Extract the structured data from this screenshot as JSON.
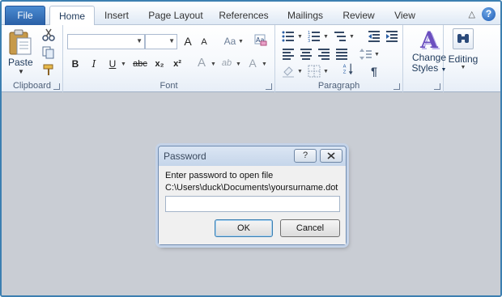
{
  "tabs": {
    "file": "File",
    "items": [
      "Home",
      "Insert",
      "Page Layout",
      "References",
      "Mailings",
      "Review",
      "View"
    ],
    "active": "Home"
  },
  "ribbon": {
    "clipboard": {
      "label": "Clipboard",
      "paste": "Paste"
    },
    "font": {
      "label": "Font",
      "font_name_value": "",
      "font_size_value": "",
      "grow": "A",
      "shrink": "A",
      "change_case": "Aa",
      "bold": "B",
      "italic": "I",
      "underline": "U",
      "strike": "abc",
      "subscript": "x₂",
      "superscript": "x²",
      "text_effects": "A",
      "highlight": "ab",
      "font_color": "A"
    },
    "paragraph": {
      "label": "Paragraph",
      "pilcrow": "¶"
    },
    "styles": {
      "label_line1": "Change",
      "label_line2": "Styles",
      "glyph": "A"
    },
    "editing": {
      "label": "Editing"
    }
  },
  "dialog": {
    "title": "Password",
    "help_button": "?",
    "prompt": "Enter password to open file",
    "path": "C:\\Users\\duck\\Documents\\yoursurname.dot",
    "password_value": "",
    "ok": "OK",
    "cancel": "Cancel"
  },
  "colors": {
    "accent": "#2a5fa6",
    "workspace": "#c9cdd4",
    "styles_glyph": "#6b4fbf"
  }
}
